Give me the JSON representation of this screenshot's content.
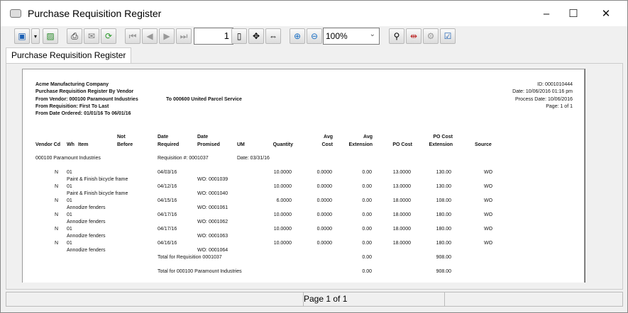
{
  "window": {
    "title": "Purchase Requisition Register",
    "controls": [
      "–",
      "☐",
      "✕"
    ]
  },
  "toolbar": {
    "page_number": "1",
    "zoom": "100%"
  },
  "tab": "Purchase Requisition Register",
  "report": {
    "header_left": [
      "Acme Manufacturing Company",
      "Purchase Requisition Register By Vendor",
      "From Vendor: 000100 Paramount Industries",
      "From Requisition: First To Last",
      "From Date Ordered: 01/01/16 To 06/01/16"
    ],
    "to_vendor": "To 000600 United Parcel Service",
    "header_right": [
      "ID: 0001010444",
      "Date: 10/06/2016 01:16 pm",
      "Process Date: 10/06/2016",
      "Page: 1 of 1"
    ],
    "columns": {
      "vendor_cd": "Vendor Cd",
      "wh": "Wh",
      "item": "Item",
      "not_before": [
        "Not",
        "Before"
      ],
      "date_required": [
        "Date",
        "Required"
      ],
      "date_promised": [
        "Date",
        "Promised"
      ],
      "um": "UM",
      "quantity": "Quantity",
      "avg_cost": [
        "Avg",
        "Cost"
      ],
      "avg_extension": [
        "Avg",
        "Extension"
      ],
      "po_cost": "PO Cost",
      "po_cost_extension": [
        "PO Cost",
        "Extension"
      ],
      "source": "Source"
    },
    "vendor_line": {
      "vendor": "000100 Paramount Industries",
      "requisition": "Requisition #: 0001037",
      "date": "Date: 03/31/16"
    },
    "rows": [
      {
        "n": "N",
        "wh": "01",
        "desc": "Paint & Finish bicycle frame",
        "required": "04/03/16",
        "promised": "WO: 0001039",
        "qty": "10.0000",
        "avg_cost": "0.0000",
        "avg_ext": "0.00",
        "po_cost": "13.0000",
        "po_ext": "130.00",
        "source": "WO"
      },
      {
        "n": "N",
        "wh": "01",
        "desc": "Paint & Finish bicycle frame",
        "required": "04/12/16",
        "promised": "WO: 0001040",
        "qty": "10.0000",
        "avg_cost": "0.0000",
        "avg_ext": "0.00",
        "po_cost": "13.0000",
        "po_ext": "130.00",
        "source": "WO"
      },
      {
        "n": "N",
        "wh": "01",
        "desc": "Annodize fenders",
        "required": "04/15/16",
        "promised": "WO: 0001061",
        "qty": "6.0000",
        "avg_cost": "0.0000",
        "avg_ext": "0.00",
        "po_cost": "18.0000",
        "po_ext": "108.00",
        "source": "WO"
      },
      {
        "n": "N",
        "wh": "01",
        "desc": "Annodize fenders",
        "required": "04/17/16",
        "promised": "WO: 0001062",
        "qty": "10.0000",
        "avg_cost": "0.0000",
        "avg_ext": "0.00",
        "po_cost": "18.0000",
        "po_ext": "180.00",
        "source": "WO"
      },
      {
        "n": "N",
        "wh": "01",
        "desc": "Annodize fenders",
        "required": "04/17/16",
        "promised": "WO: 0001063",
        "qty": "10.0000",
        "avg_cost": "0.0000",
        "avg_ext": "0.00",
        "po_cost": "18.0000",
        "po_ext": "180.00",
        "source": "WO"
      },
      {
        "n": "N",
        "wh": "01",
        "desc": "Annodize fenders",
        "required": "04/16/16",
        "promised": "WO: 0001064",
        "qty": "10.0000",
        "avg_cost": "0.0000",
        "avg_ext": "0.00",
        "po_cost": "18.0000",
        "po_ext": "180.00",
        "source": "WO"
      }
    ],
    "totals": [
      {
        "label": "Total for Requisition 0001037",
        "avg_ext": "0.00",
        "po_ext": "908.00"
      },
      {
        "label": "Total for 000100 Paramount Industries",
        "avg_ext": "0.00",
        "po_ext": "908.00"
      }
    ]
  },
  "status": {
    "page": "Page 1 of 1"
  }
}
